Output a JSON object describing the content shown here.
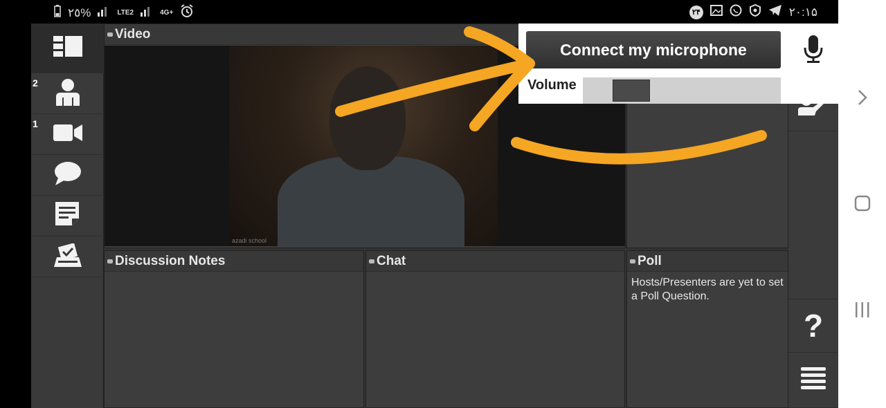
{
  "status_bar": {
    "battery": "٢٥%",
    "network": "4G+",
    "lte": "LTE2",
    "clock": "٢٠:١۵",
    "notification_count": "٢۴"
  },
  "sidebar": {
    "items": [
      {
        "icon": "layout-icon",
        "badge": ""
      },
      {
        "icon": "user-icon",
        "badge": "2"
      },
      {
        "icon": "camera-icon",
        "badge": "1"
      },
      {
        "icon": "chat-bubble-icon",
        "badge": ""
      },
      {
        "icon": "notes-icon",
        "badge": ""
      },
      {
        "icon": "vote-icon",
        "badge": ""
      }
    ]
  },
  "panels": {
    "video": {
      "title": "Video",
      "watermark": "azadi school"
    },
    "notes": {
      "title": "Discussion Notes"
    },
    "chat": {
      "title": "Chat"
    },
    "poll": {
      "title": "Poll",
      "body": "Hosts/Presenters are yet to set a Poll Question."
    }
  },
  "popover": {
    "connect_label": "Connect my microphone",
    "volume_label": "Volume",
    "volume_level": 0.15
  },
  "right_rail": {
    "help_label": "?"
  },
  "colors": {
    "annotation": "#f5a623",
    "panel_bg": "#3d3d3d",
    "sidebar_bg": "#3a3a3a"
  }
}
